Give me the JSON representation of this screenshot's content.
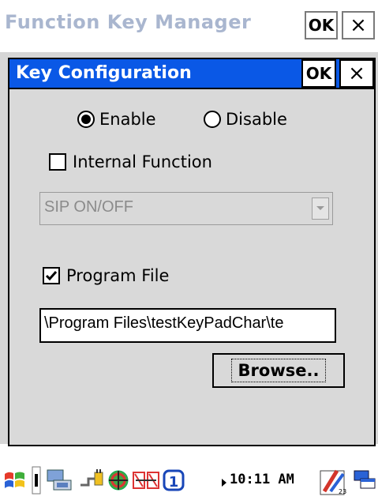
{
  "outer_window": {
    "title": "Function Key Manager",
    "ok_label": "OK",
    "close_label": "×"
  },
  "dialog": {
    "title": "Key Configuration",
    "ok_label": "OK",
    "close_label": "×",
    "radio_enable": "Enable",
    "radio_disable": "Disable",
    "selected_radio": "Enable",
    "internal_function_label": "Internal Function",
    "internal_function_checked": false,
    "function_select_value": "SIP ON/OFF",
    "program_file_label": "Program File",
    "program_file_checked": true,
    "program_path_value": "\\Program Files\\testKeyPadChar\\te",
    "browse_label": "Browse.."
  },
  "taskbar": {
    "clock": "10:11 AM",
    "icons": [
      "start-flag-icon",
      "input-panel-icon",
      "network-icon",
      "power-icon",
      "globe-icon",
      "connection-icon",
      "sim-1-icon",
      "expand-arrow-icon",
      "sip-keyboard-icon",
      "window-switch-icon"
    ]
  },
  "colors": {
    "dialog_title_bg": "#0a58e6",
    "outer_title_text": "#a9b6cf",
    "window_bg": "#d9d9d9"
  }
}
